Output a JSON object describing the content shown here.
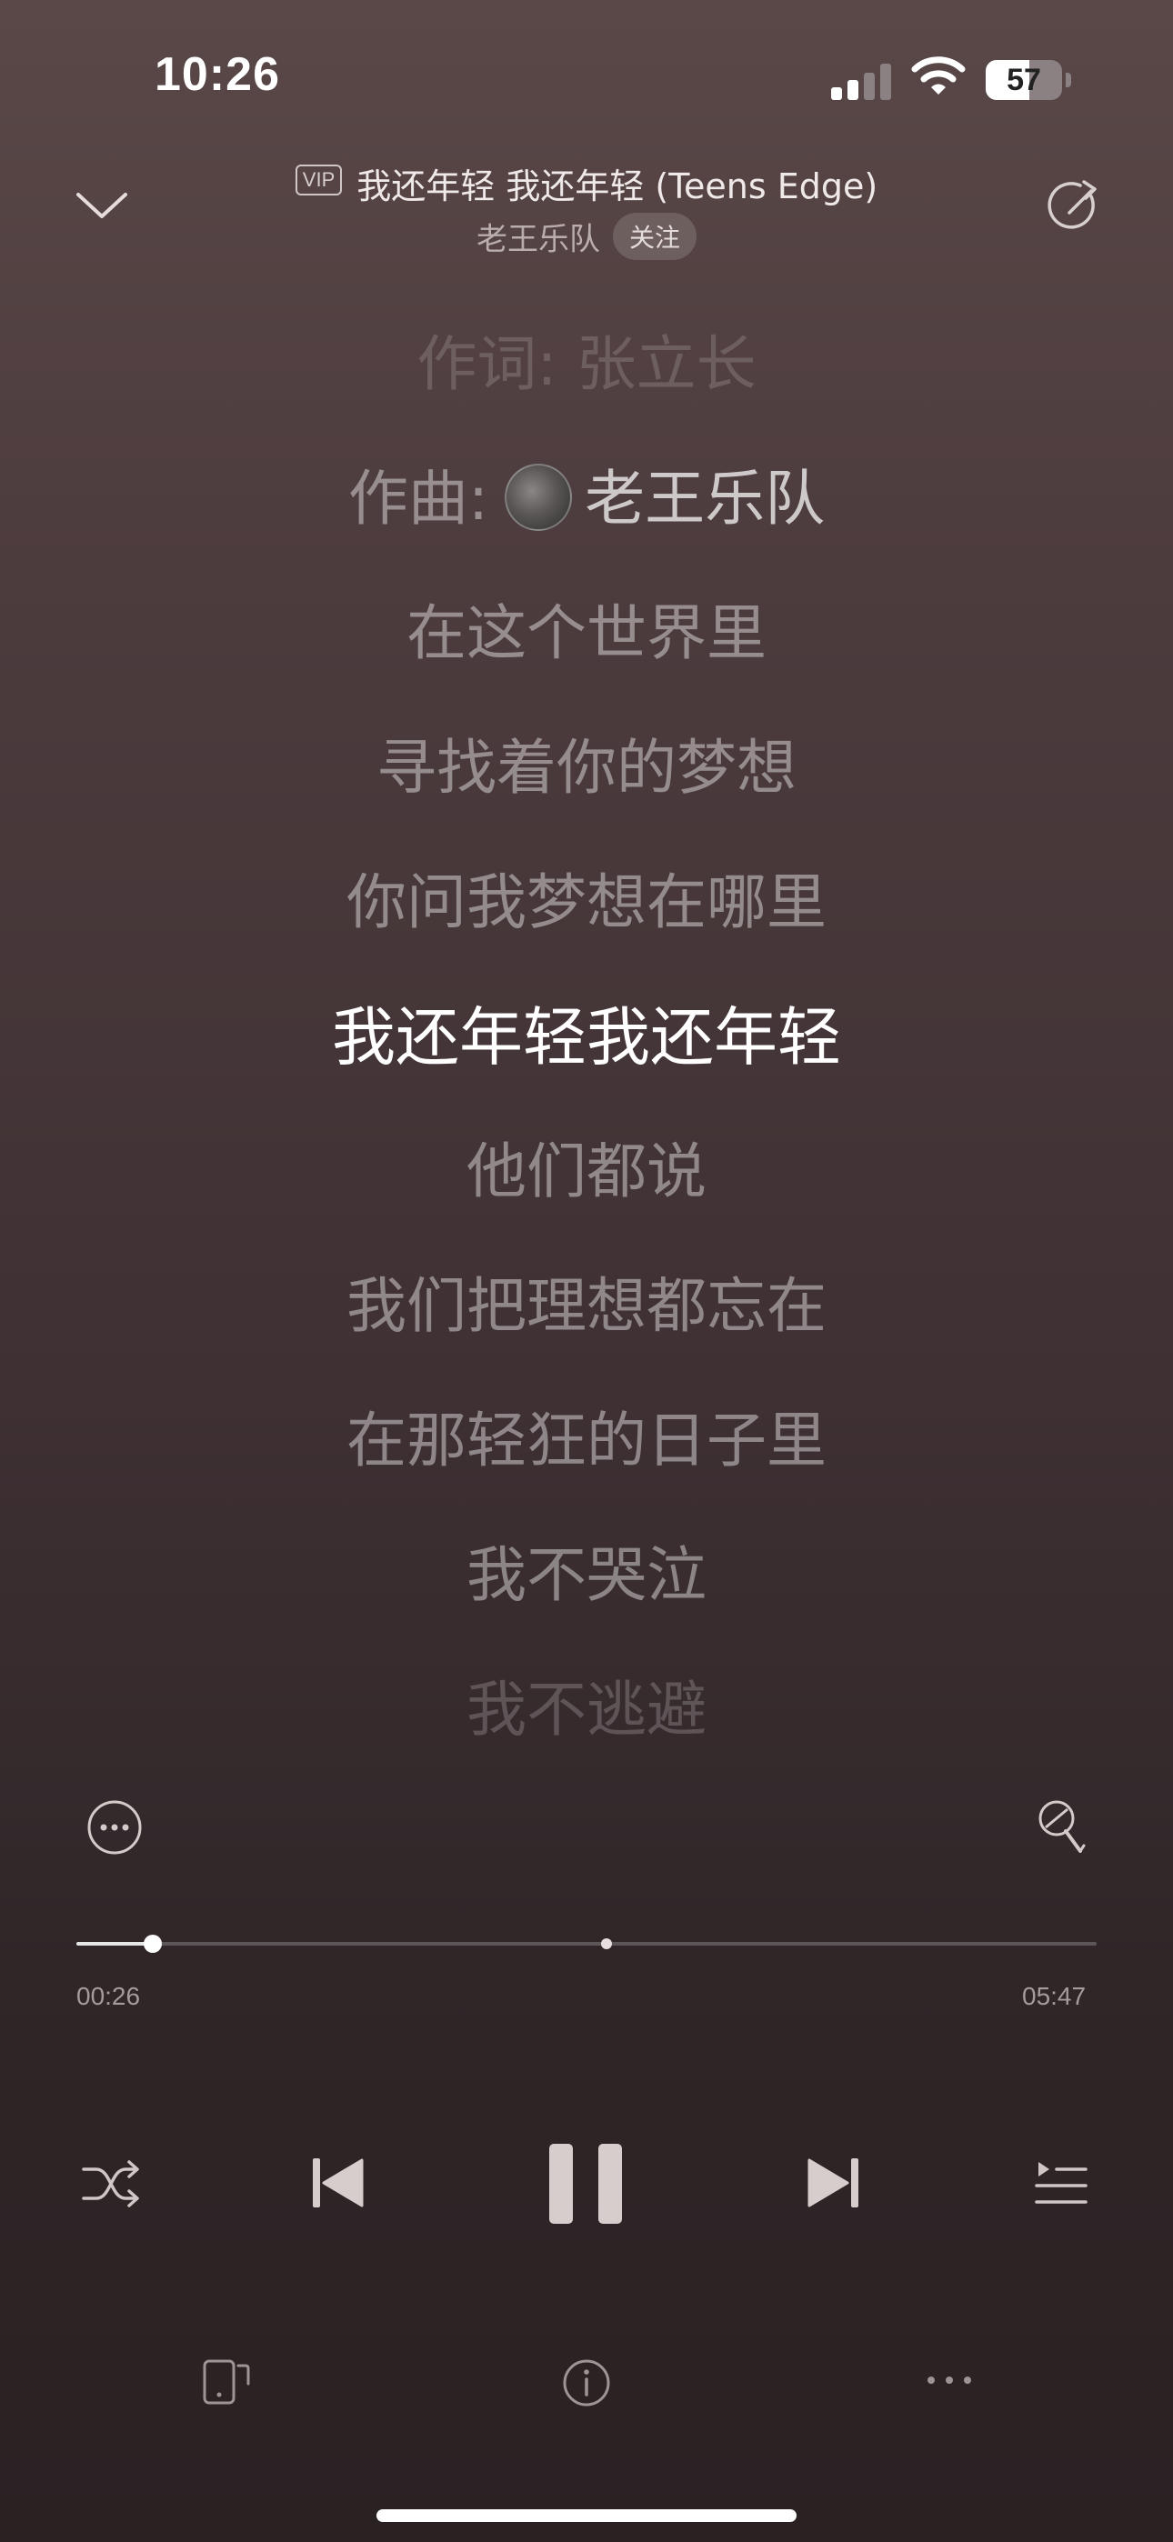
{
  "status_bar": {
    "time": "10:26",
    "battery_level": "57",
    "battery_fraction": 0.57,
    "signal_bars_active": 2,
    "signal_bars_total": 4
  },
  "header": {
    "vip_badge": "VIP",
    "song_title": "我还年轻 我还年轻 (Teens Edge)",
    "artist": "老王乐队",
    "follow_label": "关注"
  },
  "lyrics": {
    "lines": [
      {
        "text": "作词: 张立长"
      },
      {
        "label": "作曲:",
        "name": "老王乐队"
      },
      {
        "text": "在这个世界里"
      },
      {
        "text": "寻找着你的梦想"
      },
      {
        "text": "你问我梦想在哪里"
      },
      {
        "text": "我还年轻我还年轻"
      },
      {
        "text": "他们都说"
      },
      {
        "text": "我们把理想都忘在"
      },
      {
        "text": "在那轻狂的日子里"
      },
      {
        "text": "我不哭泣"
      },
      {
        "text": "我不逃避"
      }
    ],
    "active_index": 5
  },
  "progress": {
    "current": "00:26",
    "total": "05:47",
    "played_fraction": 0.075,
    "marker_fraction": 0.52
  },
  "icons": {
    "collapse": "chevron-down-icon",
    "share": "share-icon",
    "more_options": "more-circle-icon",
    "karaoke": "microphone-icon",
    "shuffle": "shuffle-icon",
    "previous": "previous-icon",
    "pause": "pause-icon",
    "next": "next-icon",
    "playlist": "playlist-icon",
    "device": "device-icon",
    "info": "info-icon",
    "more": "more-dots-icon"
  }
}
